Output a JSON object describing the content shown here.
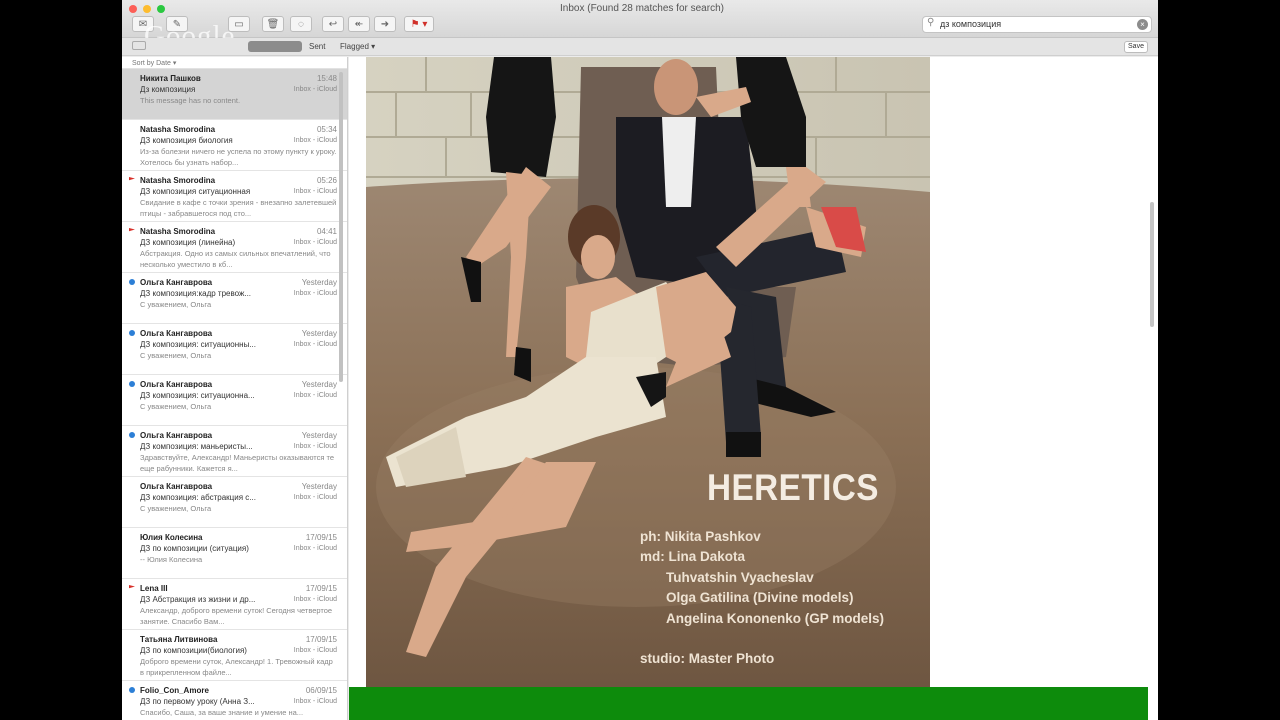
{
  "window": {
    "title": "Inbox (Found 28 matches for search)"
  },
  "watermark": "Google",
  "toolbar": {
    "buttons": [
      {
        "name": "get-mail-button",
        "icon": "envelope-icon",
        "glyph": "✉"
      },
      {
        "name": "compose-button",
        "icon": "compose-icon",
        "glyph": "✎"
      },
      {
        "name": "archive-button",
        "icon": "archive-icon",
        "glyph": "▭"
      },
      {
        "name": "trash-button",
        "icon": "trash-icon",
        "glyph": "🗑"
      },
      {
        "name": "junk-button",
        "icon": "junk-icon",
        "glyph": "◌"
      },
      {
        "name": "reply-button",
        "icon": "reply-icon",
        "glyph": "↩"
      },
      {
        "name": "reply-all-button",
        "icon": "reply-all-icon",
        "glyph": "↞"
      },
      {
        "name": "forward-button",
        "icon": "forward-icon",
        "glyph": "➜"
      },
      {
        "name": "flag-button",
        "icon": "flag-icon",
        "glyph": "⚑ ▾"
      }
    ]
  },
  "search": {
    "value": "дз композиция",
    "icon": "search-icon",
    "clear_icon": "clear-icon"
  },
  "scope": {
    "items": [
      {
        "label": "Sent",
        "active": false
      },
      {
        "label": "Flagged ▾",
        "active": false
      }
    ],
    "save_label": "Save"
  },
  "sort_label": "Sort by Date ▾",
  "messages": [
    {
      "from": "Никита Пашков",
      "date": "15:48",
      "subject": "Дз композиция",
      "mailbox": "Inbox - iCloud",
      "preview": "This message has no content.",
      "icon": "none",
      "selected": true
    },
    {
      "from": "Natasha Smorodina",
      "date": "05:34",
      "subject": "ДЗ композиция биология",
      "mailbox": "Inbox - iCloud",
      "preview": "Из-за болезни ничего не успела по этому пункту к уроку. Хотелось бы узнать набор...",
      "icon": "none",
      "selected": false
    },
    {
      "from": "Natasha Smorodina",
      "date": "05:26",
      "subject": "ДЗ композиция ситуационная",
      "mailbox": "Inbox - iCloud",
      "preview": "Свидание в кафе с точки зрения - внезапно залетевшей птицы - забравшегося под сто...",
      "icon": "flag",
      "selected": false
    },
    {
      "from": "Natasha Smorodina",
      "date": "04:41",
      "subject": "ДЗ композиция (линейна)",
      "mailbox": "Inbox - iCloud",
      "preview": "Абстракция. Одно из самых сильных впечатлений, что несколько уместило в кб...",
      "icon": "flag",
      "selected": false
    },
    {
      "from": "Ольга Кангаврова",
      "date": "Yesterday",
      "subject": "ДЗ композиция:кадр тревож...",
      "mailbox": "Inbox - iCloud",
      "preview": "С уважением, Ольга",
      "icon": "dot",
      "selected": false
    },
    {
      "from": "Ольга Кангаврова",
      "date": "Yesterday",
      "subject": "ДЗ композиция: ситуационны...",
      "mailbox": "Inbox - iCloud",
      "preview": "С уважением, Ольга",
      "icon": "dot",
      "selected": false
    },
    {
      "from": "Ольга Кангаврова",
      "date": "Yesterday",
      "subject": "ДЗ композиция: ситуационна...",
      "mailbox": "Inbox - iCloud",
      "preview": "С уважением, Ольга",
      "icon": "dot",
      "selected": false
    },
    {
      "from": "Ольга Кангаврова",
      "date": "Yesterday",
      "subject": "ДЗ композиция: маньеристы...",
      "mailbox": "Inbox - iCloud",
      "preview": "Здравствуйте, Александр! Маньеристы оказываются те еще рабунники. Кажется я...",
      "icon": "dot",
      "selected": false
    },
    {
      "from": "Ольга Кангаврова",
      "date": "Yesterday",
      "subject": "ДЗ композиция: абстракция с...",
      "mailbox": "Inbox - iCloud",
      "preview": "С уважением, Ольга",
      "icon": "none",
      "selected": false
    },
    {
      "from": "Юлия Колесина",
      "date": "17/09/15",
      "subject": "ДЗ по композиции (ситуация)",
      "mailbox": "Inbox - iCloud",
      "preview": "-- Юлия Колесина",
      "icon": "none",
      "selected": false
    },
    {
      "from": "Lena III",
      "date": "17/09/15",
      "subject": "ДЗ Абстракция из жизни и др...",
      "mailbox": "Inbox - iCloud",
      "preview": "Александр, доброго времени суток! Сегодня четвертое занятие. Спасибо Вам...",
      "icon": "flag",
      "selected": false
    },
    {
      "from": "Татьяна Литвинова",
      "date": "17/09/15",
      "subject": "ДЗ по композиции(биология)",
      "mailbox": "Inbox - iCloud",
      "preview": "Доброго времени суток, Александр! 1. Тревожный кадр в прикрепленном файле...",
      "icon": "none",
      "selected": false
    },
    {
      "from": "Folio_Con_Amore",
      "date": "06/09/15",
      "subject": "ДЗ по первому уроку (Анна З...",
      "mailbox": "Inbox - iCloud",
      "preview": "Спасибо, Саша, за ваше знание и умение на...",
      "icon": "dot",
      "selected": false
    }
  ],
  "poster": {
    "title": "HERETICS",
    "credits": [
      "ph: Nikita Pashkov",
      "md: Lina Dakota",
      "Tuhvatshin Vyacheslav",
      "Olga Gatilina (Divine models)",
      "Angelina Kononenko (GP models)",
      "studio: Master Photo"
    ]
  },
  "colors": {
    "accent_green": "#0d8b0c",
    "flag_red": "#d8302a",
    "unread_blue": "#2c7fd6"
  }
}
